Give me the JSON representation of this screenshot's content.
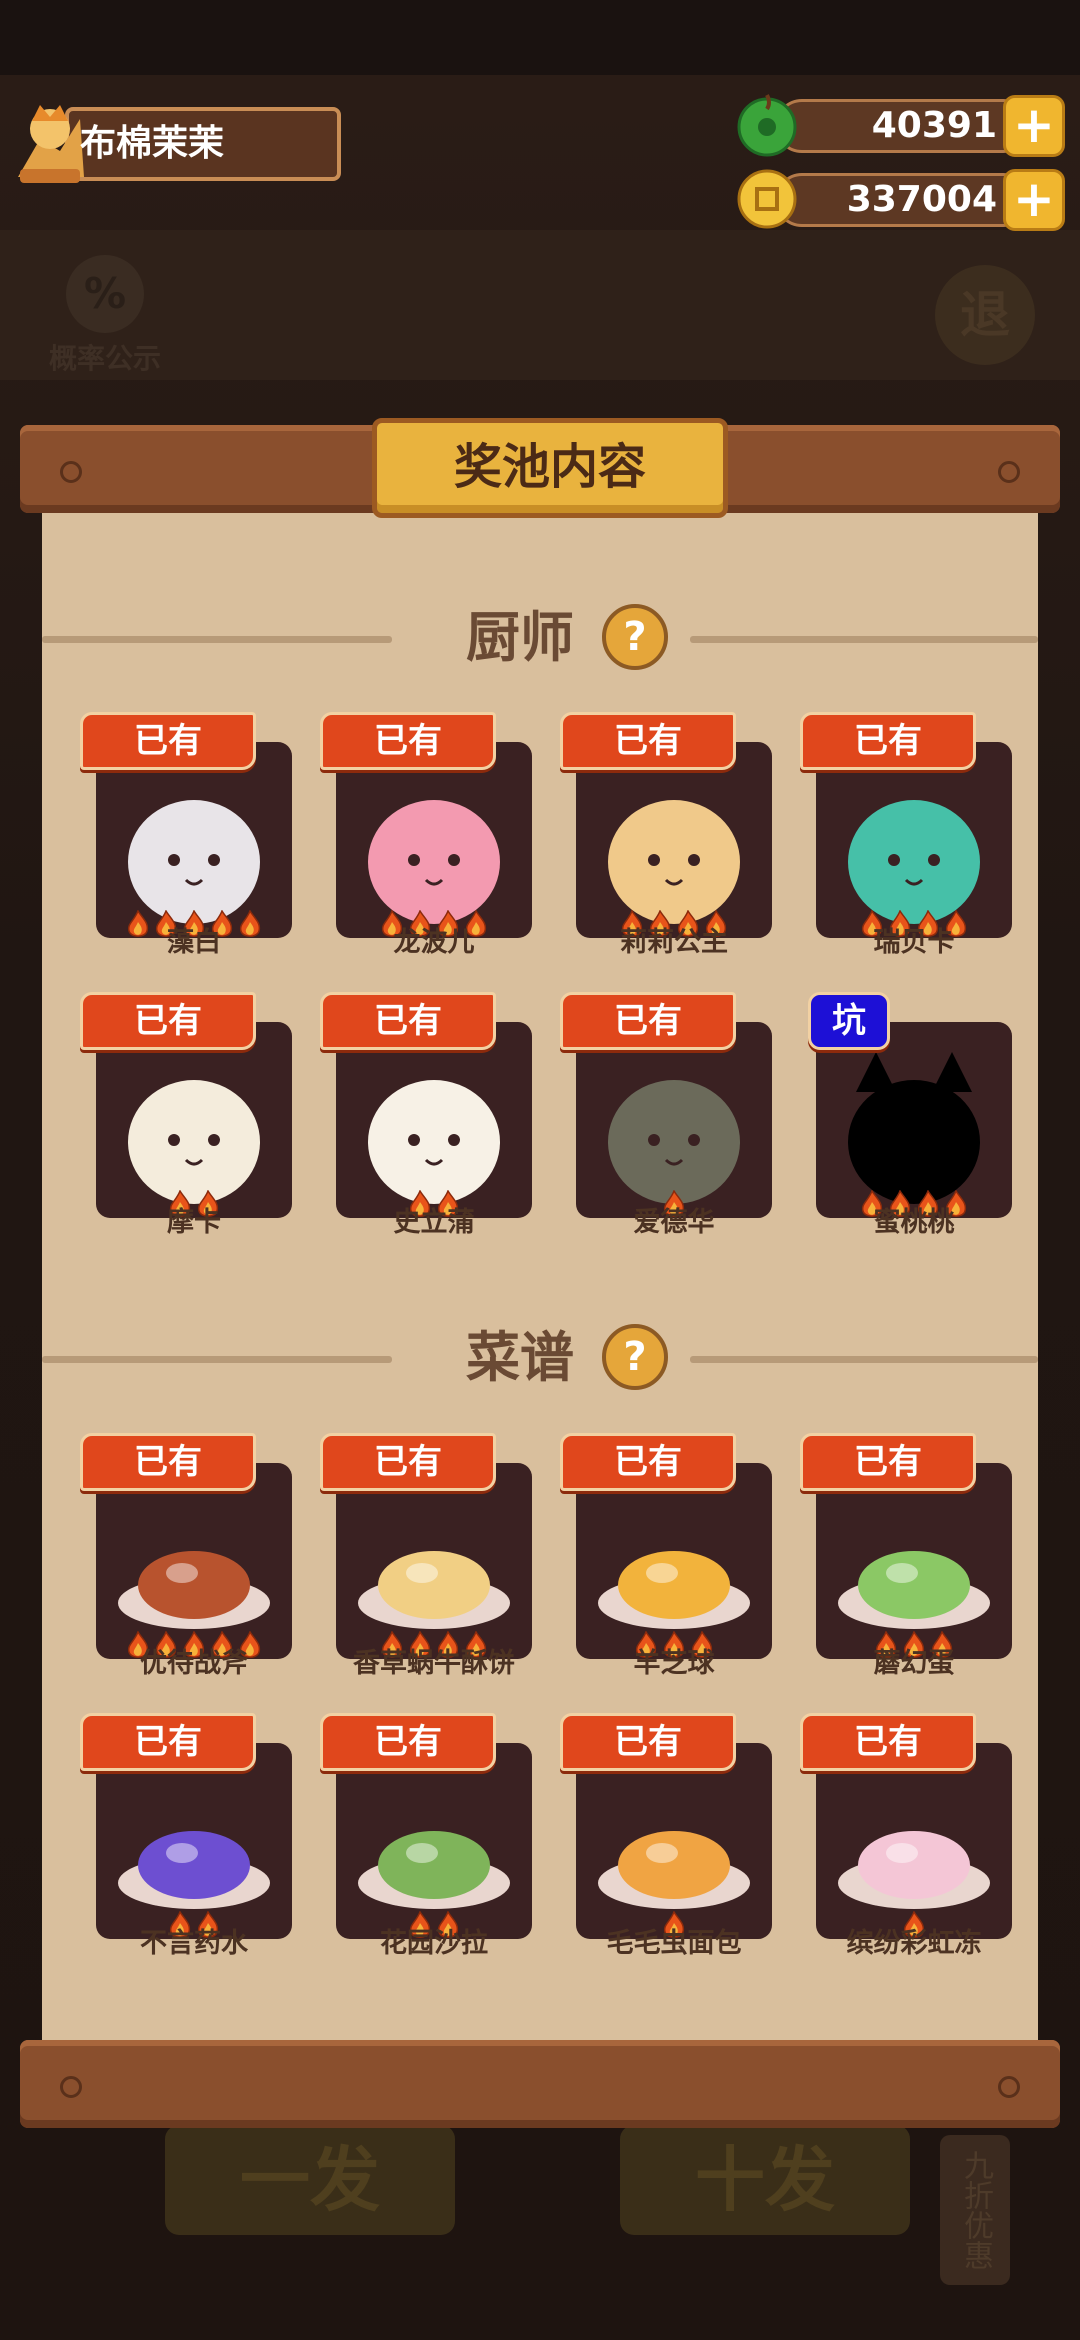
{
  "player": {
    "name": "布棉茉茉"
  },
  "currency": {
    "jade": "40391",
    "coins": "337004"
  },
  "background": {
    "probability_label": "概率公示",
    "exit_label": "退",
    "single_draw": "一发",
    "ten_draw": "十发",
    "discount": "九折优惠"
  },
  "panel": {
    "title": "奖池内容"
  },
  "sections": {
    "chefs": {
      "title": "厨师"
    },
    "recipes": {
      "title": "菜谱"
    }
  },
  "chefs": [
    {
      "tag": "已有",
      "name": "藻白",
      "stars": 5,
      "art_color": "#e8e4e8"
    },
    {
      "tag": "已有",
      "name": "龙波儿",
      "stars": 4,
      "art_color": "#f39ab0"
    },
    {
      "tag": "已有",
      "name": "莉莉公主",
      "stars": 4,
      "art_color": "#f0c98a"
    },
    {
      "tag": "已有",
      "name": "瑞贝卡",
      "stars": 4,
      "art_color": "#46c0a8"
    },
    {
      "tag": "已有",
      "name": "摩卡",
      "stars": 2,
      "art_color": "#f4ecdc"
    },
    {
      "tag": "已有",
      "name": "史立蒲",
      "stars": 2,
      "art_color": "#f7f1e6"
    },
    {
      "tag": "已有",
      "name": "爱德华",
      "stars": 1,
      "art_color": "#6b6a5a"
    },
    {
      "tag": "坑",
      "name": "蜜桃桃",
      "stars": 4,
      "art_color": "#000000",
      "tag_style": "blue"
    }
  ],
  "recipes": [
    {
      "tag": "已有",
      "name": "优待战斧",
      "stars": 5,
      "art_color": "#b8532e"
    },
    {
      "tag": "已有",
      "name": "香草蜗牛酥饼",
      "stars": 4,
      "art_color": "#f1cf84"
    },
    {
      "tag": "已有",
      "name": "羊芝球",
      "stars": 3,
      "art_color": "#f2b33c"
    },
    {
      "tag": "已有",
      "name": "蘑幻蛋",
      "stars": 3,
      "art_color": "#8bc865"
    },
    {
      "tag": "已有",
      "name": "不言药水",
      "stars": 2,
      "art_color": "#6d4fd1"
    },
    {
      "tag": "已有",
      "name": "花园沙拉",
      "stars": 2,
      "art_color": "#7fb45a"
    },
    {
      "tag": "已有",
      "name": "毛毛虫面包",
      "stars": 1,
      "art_color": "#f0a443"
    },
    {
      "tag": "已有",
      "name": "缤纷彩虹冻",
      "stars": 1,
      "art_color": "#f4c6d6"
    }
  ],
  "icons": {
    "flame": "flame-icon",
    "jade": "jade-icon",
    "coin": "coin-icon",
    "plus": "plus-icon",
    "help": "help-icon"
  },
  "colors": {
    "owned_tag": "#e0471c",
    "missing_tag": "#1d10d6",
    "panel": "#d9bf9d",
    "title": "#e9b33e"
  }
}
